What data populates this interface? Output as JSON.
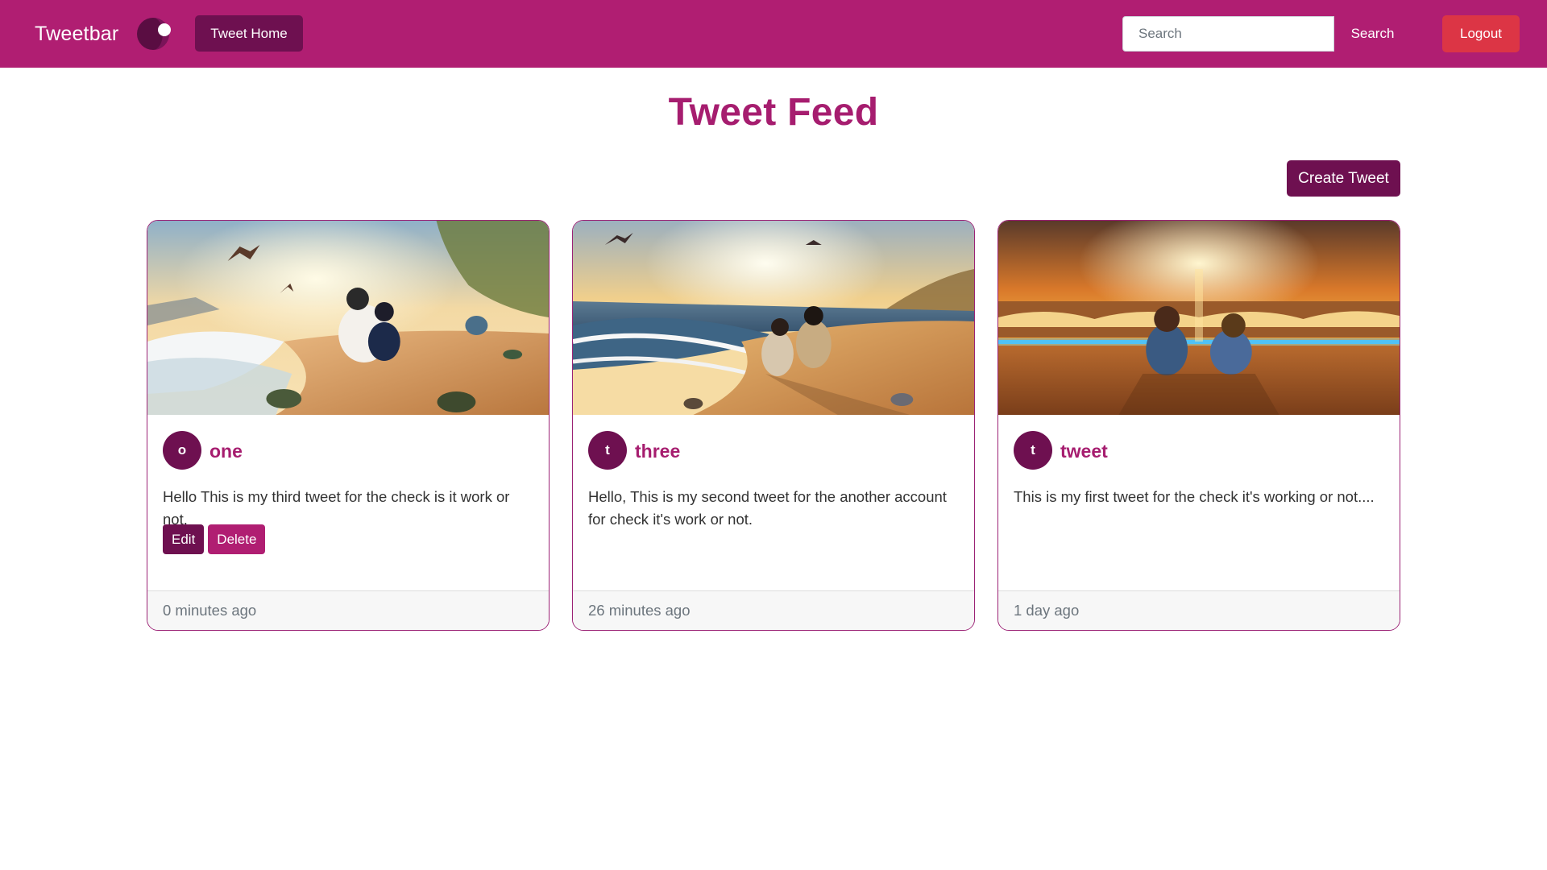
{
  "navbar": {
    "brand": "Tweetbar",
    "home_label": "Tweet Home",
    "search_placeholder": "Search",
    "search_button": "Search",
    "logout_label": "Logout"
  },
  "page": {
    "title": "Tweet Feed",
    "create_label": "Create Tweet"
  },
  "colors": {
    "navbar": "#b01e72",
    "primary_dark": "#6e1050",
    "accent": "#a61d6f",
    "danger": "#dc3545"
  },
  "tweets": [
    {
      "initial": "o",
      "username": "one",
      "text": "Hello This is my third tweet for the check is it work or not.",
      "time": "0 minutes ago",
      "edit_label": "Edit",
      "delete_label": "Delete"
    },
    {
      "initial": "t",
      "username": "three",
      "text": "Hello, This is my second tweet for the another account for check it's work or not.",
      "time": "26 minutes ago"
    },
    {
      "initial": "t",
      "username": "tweet",
      "text": "This is my first tweet for the check it's working or not....",
      "time": "1 day ago"
    }
  ]
}
